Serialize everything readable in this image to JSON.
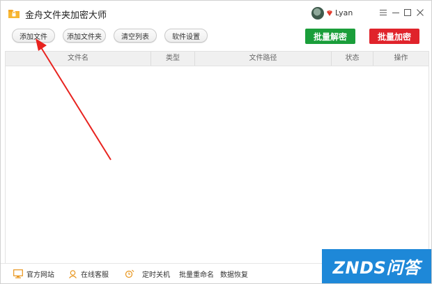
{
  "window": {
    "title": "金舟文件夹加密大师",
    "user_name": "Lyan"
  },
  "toolbar": {
    "add_file": "添加文件",
    "add_folder": "添加文件夹",
    "clear_list": "清空列表",
    "settings": "软件设置",
    "batch_decrypt": "批量解密",
    "batch_encrypt": "批量加密"
  },
  "table": {
    "columns": [
      "文件名",
      "类型",
      "文件路径",
      "状态",
      "操作"
    ],
    "rows": []
  },
  "statusbar": {
    "website": "官方网站",
    "support": "在线客服",
    "shutdown": "定时关机",
    "rename": "批量重命名",
    "recovery": "数据恢复"
  },
  "watermark": {
    "text": "ZNDS问答"
  },
  "colors": {
    "decrypt_green": "#1a9e3a",
    "encrypt_red": "#e0232b",
    "annotation_red": "#e8231f",
    "header_bg": "#f0f0f0",
    "watermark_blue": "#1e88d8"
  },
  "icons": {
    "app": "folder-lock-icon",
    "vip": "vip-gem-icon",
    "menu": "hamburger-menu-icon",
    "minimize": "minimize-icon",
    "maximize": "maximize-icon",
    "close": "close-icon",
    "website": "monitor-icon",
    "support": "headset-icon",
    "shutdown": "clock-power-icon"
  }
}
